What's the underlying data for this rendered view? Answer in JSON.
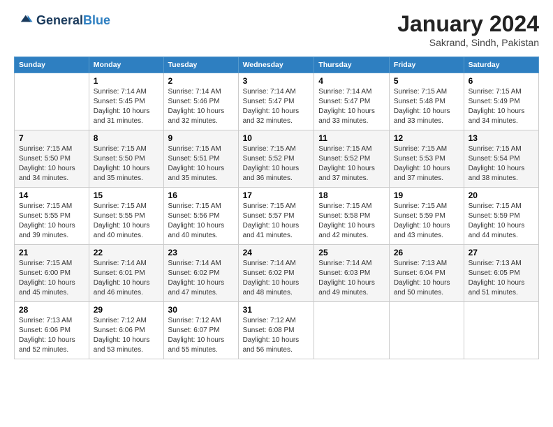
{
  "logo": {
    "line1": "General",
    "line2": "Blue"
  },
  "title": "January 2024",
  "subtitle": "Sakrand, Sindh, Pakistan",
  "days_of_week": [
    "Sunday",
    "Monday",
    "Tuesday",
    "Wednesday",
    "Thursday",
    "Friday",
    "Saturday"
  ],
  "weeks": [
    [
      {
        "day": "",
        "sunrise": "",
        "sunset": "",
        "daylight": ""
      },
      {
        "day": "1",
        "sunrise": "Sunrise: 7:14 AM",
        "sunset": "Sunset: 5:45 PM",
        "daylight": "Daylight: 10 hours and 31 minutes."
      },
      {
        "day": "2",
        "sunrise": "Sunrise: 7:14 AM",
        "sunset": "Sunset: 5:46 PM",
        "daylight": "Daylight: 10 hours and 32 minutes."
      },
      {
        "day": "3",
        "sunrise": "Sunrise: 7:14 AM",
        "sunset": "Sunset: 5:47 PM",
        "daylight": "Daylight: 10 hours and 32 minutes."
      },
      {
        "day": "4",
        "sunrise": "Sunrise: 7:14 AM",
        "sunset": "Sunset: 5:47 PM",
        "daylight": "Daylight: 10 hours and 33 minutes."
      },
      {
        "day": "5",
        "sunrise": "Sunrise: 7:15 AM",
        "sunset": "Sunset: 5:48 PM",
        "daylight": "Daylight: 10 hours and 33 minutes."
      },
      {
        "day": "6",
        "sunrise": "Sunrise: 7:15 AM",
        "sunset": "Sunset: 5:49 PM",
        "daylight": "Daylight: 10 hours and 34 minutes."
      }
    ],
    [
      {
        "day": "7",
        "sunrise": "Sunrise: 7:15 AM",
        "sunset": "Sunset: 5:50 PM",
        "daylight": "Daylight: 10 hours and 34 minutes."
      },
      {
        "day": "8",
        "sunrise": "Sunrise: 7:15 AM",
        "sunset": "Sunset: 5:50 PM",
        "daylight": "Daylight: 10 hours and 35 minutes."
      },
      {
        "day": "9",
        "sunrise": "Sunrise: 7:15 AM",
        "sunset": "Sunset: 5:51 PM",
        "daylight": "Daylight: 10 hours and 35 minutes."
      },
      {
        "day": "10",
        "sunrise": "Sunrise: 7:15 AM",
        "sunset": "Sunset: 5:52 PM",
        "daylight": "Daylight: 10 hours and 36 minutes."
      },
      {
        "day": "11",
        "sunrise": "Sunrise: 7:15 AM",
        "sunset": "Sunset: 5:52 PM",
        "daylight": "Daylight: 10 hours and 37 minutes."
      },
      {
        "day": "12",
        "sunrise": "Sunrise: 7:15 AM",
        "sunset": "Sunset: 5:53 PM",
        "daylight": "Daylight: 10 hours and 37 minutes."
      },
      {
        "day": "13",
        "sunrise": "Sunrise: 7:15 AM",
        "sunset": "Sunset: 5:54 PM",
        "daylight": "Daylight: 10 hours and 38 minutes."
      }
    ],
    [
      {
        "day": "14",
        "sunrise": "Sunrise: 7:15 AM",
        "sunset": "Sunset: 5:55 PM",
        "daylight": "Daylight: 10 hours and 39 minutes."
      },
      {
        "day": "15",
        "sunrise": "Sunrise: 7:15 AM",
        "sunset": "Sunset: 5:55 PM",
        "daylight": "Daylight: 10 hours and 40 minutes."
      },
      {
        "day": "16",
        "sunrise": "Sunrise: 7:15 AM",
        "sunset": "Sunset: 5:56 PM",
        "daylight": "Daylight: 10 hours and 40 minutes."
      },
      {
        "day": "17",
        "sunrise": "Sunrise: 7:15 AM",
        "sunset": "Sunset: 5:57 PM",
        "daylight": "Daylight: 10 hours and 41 minutes."
      },
      {
        "day": "18",
        "sunrise": "Sunrise: 7:15 AM",
        "sunset": "Sunset: 5:58 PM",
        "daylight": "Daylight: 10 hours and 42 minutes."
      },
      {
        "day": "19",
        "sunrise": "Sunrise: 7:15 AM",
        "sunset": "Sunset: 5:59 PM",
        "daylight": "Daylight: 10 hours and 43 minutes."
      },
      {
        "day": "20",
        "sunrise": "Sunrise: 7:15 AM",
        "sunset": "Sunset: 5:59 PM",
        "daylight": "Daylight: 10 hours and 44 minutes."
      }
    ],
    [
      {
        "day": "21",
        "sunrise": "Sunrise: 7:15 AM",
        "sunset": "Sunset: 6:00 PM",
        "daylight": "Daylight: 10 hours and 45 minutes."
      },
      {
        "day": "22",
        "sunrise": "Sunrise: 7:14 AM",
        "sunset": "Sunset: 6:01 PM",
        "daylight": "Daylight: 10 hours and 46 minutes."
      },
      {
        "day": "23",
        "sunrise": "Sunrise: 7:14 AM",
        "sunset": "Sunset: 6:02 PM",
        "daylight": "Daylight: 10 hours and 47 minutes."
      },
      {
        "day": "24",
        "sunrise": "Sunrise: 7:14 AM",
        "sunset": "Sunset: 6:02 PM",
        "daylight": "Daylight: 10 hours and 48 minutes."
      },
      {
        "day": "25",
        "sunrise": "Sunrise: 7:14 AM",
        "sunset": "Sunset: 6:03 PM",
        "daylight": "Daylight: 10 hours and 49 minutes."
      },
      {
        "day": "26",
        "sunrise": "Sunrise: 7:13 AM",
        "sunset": "Sunset: 6:04 PM",
        "daylight": "Daylight: 10 hours and 50 minutes."
      },
      {
        "day": "27",
        "sunrise": "Sunrise: 7:13 AM",
        "sunset": "Sunset: 6:05 PM",
        "daylight": "Daylight: 10 hours and 51 minutes."
      }
    ],
    [
      {
        "day": "28",
        "sunrise": "Sunrise: 7:13 AM",
        "sunset": "Sunset: 6:06 PM",
        "daylight": "Daylight: 10 hours and 52 minutes."
      },
      {
        "day": "29",
        "sunrise": "Sunrise: 7:12 AM",
        "sunset": "Sunset: 6:06 PM",
        "daylight": "Daylight: 10 hours and 53 minutes."
      },
      {
        "day": "30",
        "sunrise": "Sunrise: 7:12 AM",
        "sunset": "Sunset: 6:07 PM",
        "daylight": "Daylight: 10 hours and 55 minutes."
      },
      {
        "day": "31",
        "sunrise": "Sunrise: 7:12 AM",
        "sunset": "Sunset: 6:08 PM",
        "daylight": "Daylight: 10 hours and 56 minutes."
      },
      {
        "day": "",
        "sunrise": "",
        "sunset": "",
        "daylight": ""
      },
      {
        "day": "",
        "sunrise": "",
        "sunset": "",
        "daylight": ""
      },
      {
        "day": "",
        "sunrise": "",
        "sunset": "",
        "daylight": ""
      }
    ]
  ]
}
